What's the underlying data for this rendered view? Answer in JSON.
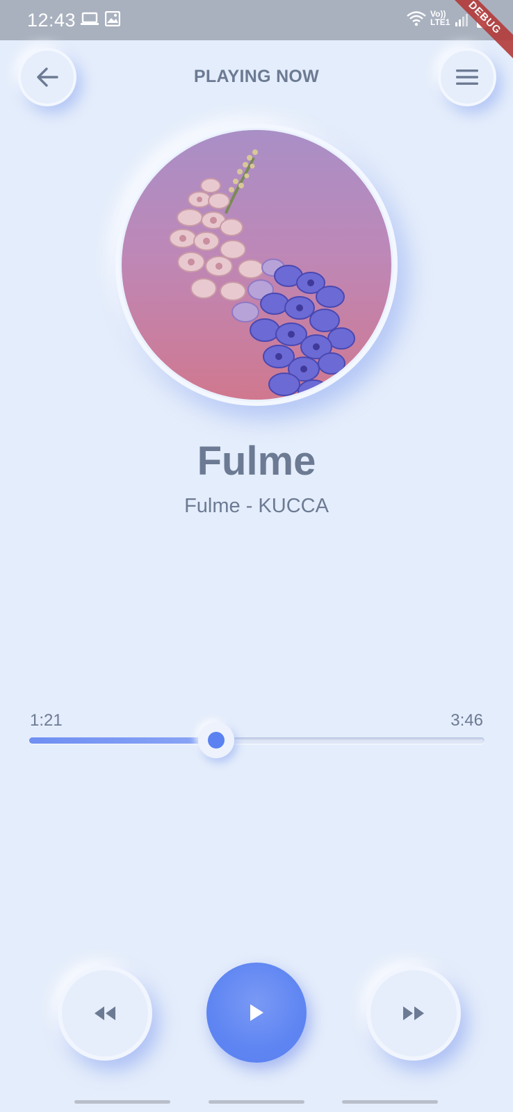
{
  "status_bar": {
    "time": "12:43",
    "network_label_line1": "Vo))",
    "network_label_line2": "LTE1",
    "debug_label": "DEBUG"
  },
  "header": {
    "title": "PLAYING NOW",
    "back_icon": "arrow-left-icon",
    "menu_icon": "menu-icon"
  },
  "song": {
    "title": "Fulme",
    "subtitle": "Fulme - KUCCA"
  },
  "progress": {
    "current": "1:21",
    "total": "3:46",
    "fraction": 0.41
  },
  "controls": {
    "rewind_icon": "rewind-icon",
    "play_icon": "play-icon",
    "forward_icon": "fast-forward-icon"
  },
  "colors": {
    "background": "#e4edfb",
    "accent": "#5b82f0",
    "text": "#6c7a93"
  }
}
